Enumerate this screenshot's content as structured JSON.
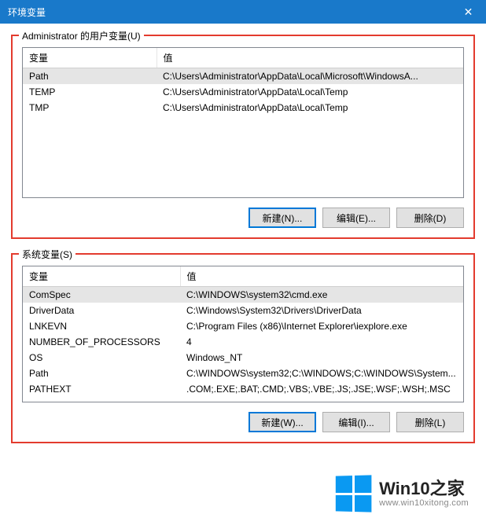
{
  "window": {
    "title": "环境变量",
    "close_glyph": "✕"
  },
  "user_section": {
    "legend": "Administrator 的用户变量(U)",
    "headers": {
      "var": "变量",
      "val": "值"
    },
    "rows": [
      {
        "var": "Path",
        "val": "C:\\Users\\Administrator\\AppData\\Local\\Microsoft\\WindowsA...",
        "selected": true
      },
      {
        "var": "TEMP",
        "val": "C:\\Users\\Administrator\\AppData\\Local\\Temp",
        "selected": false
      },
      {
        "var": "TMP",
        "val": "C:\\Users\\Administrator\\AppData\\Local\\Temp",
        "selected": false
      }
    ],
    "buttons": {
      "new": "新建(N)...",
      "edit": "编辑(E)...",
      "delete": "删除(D)"
    }
  },
  "system_section": {
    "legend": "系统变量(S)",
    "headers": {
      "var": "变量",
      "val": "值"
    },
    "rows": [
      {
        "var": "ComSpec",
        "val": "C:\\WINDOWS\\system32\\cmd.exe",
        "selected": true
      },
      {
        "var": "DriverData",
        "val": "C:\\Windows\\System32\\Drivers\\DriverData",
        "selected": false
      },
      {
        "var": "LNKEVN",
        "val": "C:\\Program Files (x86)\\Internet Explorer\\iexplore.exe",
        "selected": false
      },
      {
        "var": "NUMBER_OF_PROCESSORS",
        "val": "4",
        "selected": false
      },
      {
        "var": "OS",
        "val": "Windows_NT",
        "selected": false
      },
      {
        "var": "Path",
        "val": "C:\\WINDOWS\\system32;C:\\WINDOWS;C:\\WINDOWS\\System...",
        "selected": false
      },
      {
        "var": "PATHEXT",
        "val": ".COM;.EXE;.BAT;.CMD;.VBS;.VBE;.JS;.JSE;.WSF;.WSH;.MSC",
        "selected": false
      }
    ],
    "buttons": {
      "new": "新建(W)...",
      "edit": "编辑(I)...",
      "delete": "删除(L)"
    }
  },
  "watermark": {
    "brand": "Win10之家",
    "url": "www.win10xitong.com"
  }
}
